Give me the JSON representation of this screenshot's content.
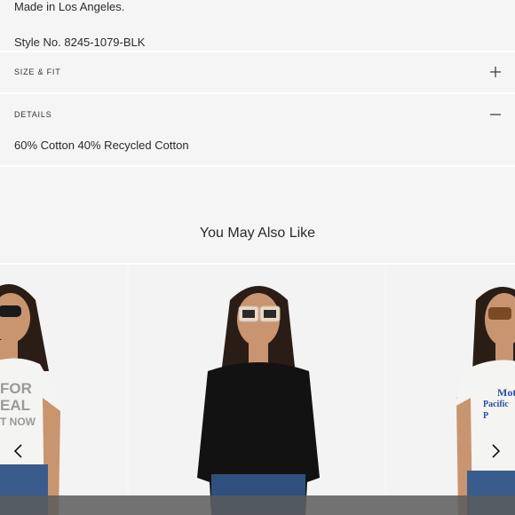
{
  "description": {
    "made_in": "Made in Los Angeles.",
    "style_no": "Style No. 8245-1079-BLK"
  },
  "accordion": {
    "size_fit": {
      "label": "SIZE & FIT",
      "icon": "plus-icon",
      "expanded": false
    },
    "details": {
      "label": "DETAILS",
      "icon": "minus-icon",
      "expanded": true,
      "content": "60% Cotton 40% Recycled Cotton"
    }
  },
  "recommendations": {
    "title": "You May Also Like",
    "prev_icon": "chevron-left-icon",
    "next_icon": "chevron-right-icon",
    "cards": [
      {
        "name": "product-card-left",
        "shirt_color": "#f4f4f2",
        "print_text": [
          "FOR",
          "EAL",
          "T NOW"
        ]
      },
      {
        "name": "product-card-center",
        "shirt_color": "#121212"
      },
      {
        "name": "product-card-right",
        "shirt_color": "#f4f4f2",
        "print_text": [
          "Mot",
          "Pacific P"
        ]
      }
    ]
  },
  "colors": {
    "background": "#f5f5f5",
    "divider": "#ffffff",
    "text": "#222222"
  }
}
